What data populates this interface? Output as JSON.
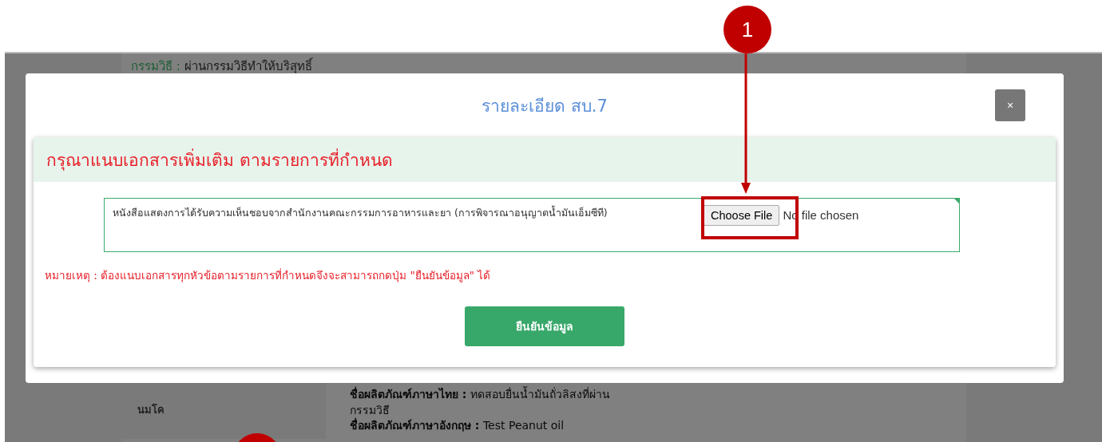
{
  "background_page": {
    "method_label": "กรรมวิธี :",
    "method_value": "ผ่านกรรมวิธีทำให้บริสุทธิ์",
    "left_cell": "นมโค",
    "details": [
      {
        "label": "ชื่อผลิตภัณฑ์ภาษาไทย :",
        "value": "ทดสอบยื่นน้ำมันถั่วลิสงที่ผ่านกรรมวิธี"
      },
      {
        "label": "ชื่อผลิตภัณฑ์ภาษาอังกฤษ :",
        "value": "Test Peanut oil"
      }
    ]
  },
  "modal": {
    "title": "รายละเอียด สบ.7",
    "close": "×",
    "section_title": "กรุณาแนบเอกสารเพิ่มเติม ตามรายการที่กำหนด",
    "documents": [
      {
        "description": "หนังสือแสดงการได้รับความเห็นชอบจากสำนักงานคณะกรรมการอาหารและยา (การพิจารณาอนุญาตน้ำมันเอ็มซีที)",
        "button": "Choose File",
        "status": "No file chosen"
      }
    ],
    "note": "หมายเหตุ : ต้องแนบเอกสารทุกหัวข้อตามรายการที่กำหนดจึงจะสามารถกดปุ่ม \"ยืนยันข้อมูล\" ได้",
    "submit": "ยืนยันข้อมูล"
  },
  "callout": {
    "number": "1"
  }
}
